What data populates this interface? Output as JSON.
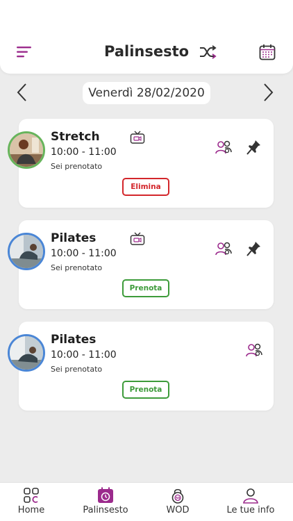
{
  "header": {
    "title": "Palinsesto",
    "icons": [
      "menu-icon",
      "shuffle-icon",
      "calendar-icon"
    ]
  },
  "date_nav": {
    "date": "Venerdì 28/02/2020",
    "icons": [
      "chevron-left-icon",
      "chevron-right-icon"
    ]
  },
  "classes": [
    {
      "name": "Stretch",
      "time": "10:00 - 11:00",
      "status": "Sei prenotato",
      "action": "Elimina",
      "action_color": "#d3262b",
      "online": true,
      "pinned": true
    },
    {
      "name": "Pilates",
      "time": "10:00 - 11:00",
      "status": "Sei prenotato",
      "action": "Prenota",
      "action_color": "#3d9b3a",
      "online": true,
      "pinned": true
    },
    {
      "name": "Pilates",
      "time": "10:00 - 11:00",
      "status": "Sei prenotato",
      "action": "Prenota",
      "action_color": "#3d9b3a",
      "online": false,
      "pinned": false
    }
  ],
  "tabs": [
    {
      "label": "Home",
      "icon": "grid-icon"
    },
    {
      "label": "Palinsesto",
      "icon": "calendar-clock-icon",
      "active": true
    },
    {
      "label": "WOD",
      "icon": "kettlebell-icon"
    },
    {
      "label": "Le tue info",
      "icon": "user-icon"
    }
  ],
  "colors": {
    "accent": "#9b2a8c",
    "elimina": "#d3262b",
    "prenota": "#3d9b3a",
    "background": "#ececec"
  }
}
